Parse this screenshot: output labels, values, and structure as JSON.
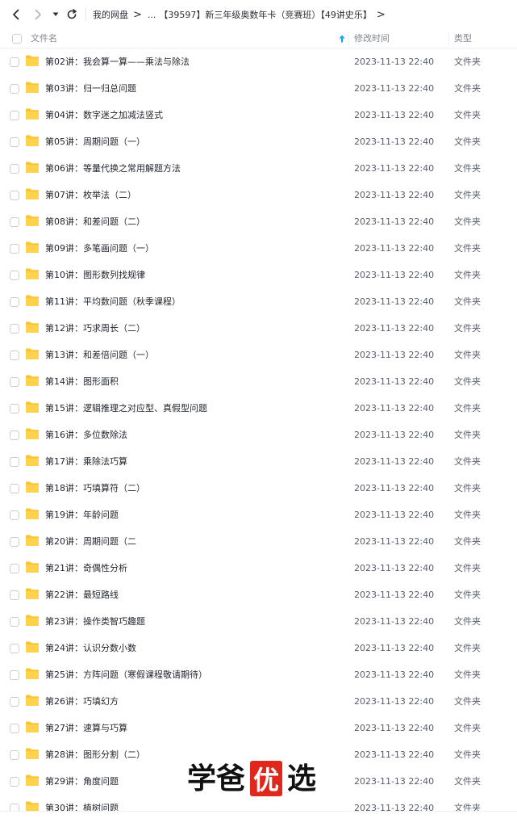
{
  "breadcrumb": {
    "root": "我的网盘",
    "ellipsis": "...",
    "current": "【39597】新三年级奥数年卡（竞赛班）【49讲史乐】"
  },
  "columns": {
    "name": "文件名",
    "modified": "修改时间",
    "type": "类型"
  },
  "sort": {
    "column": "name",
    "direction": "ascending",
    "icon": "arrow-up-icon"
  },
  "colors": {
    "folder": "#f9c531",
    "accent": "#06a7ff",
    "watermark_red": "#e0271b"
  },
  "files": [
    {
      "name": "第02讲：我会算一算——乘法与除法",
      "modified": "2023-11-13 22:40",
      "type": "文件夹"
    },
    {
      "name": "第03讲：归一归总问题",
      "modified": "2023-11-13 22:40",
      "type": "文件夹"
    },
    {
      "name": "第04讲：数字迷之加减法竖式",
      "modified": "2023-11-13 22:40",
      "type": "文件夹"
    },
    {
      "name": "第05讲：周期问题（一）",
      "modified": "2023-11-13 22:40",
      "type": "文件夹"
    },
    {
      "name": "第06讲：等量代换之常用解题方法",
      "modified": "2023-11-13 22:40",
      "type": "文件夹"
    },
    {
      "name": "第07讲：枚举法（二）",
      "modified": "2023-11-13 22:40",
      "type": "文件夹"
    },
    {
      "name": "第08讲：和差问题（二）",
      "modified": "2023-11-13 22:40",
      "type": "文件夹"
    },
    {
      "name": "第09讲：多笔画问题（一）",
      "modified": "2023-11-13 22:40",
      "type": "文件夹"
    },
    {
      "name": "第10讲：图形数列找规律",
      "modified": "2023-11-13 22:40",
      "type": "文件夹"
    },
    {
      "name": "第11讲：平均数问题（秋季课程）",
      "modified": "2023-11-13 22:40",
      "type": "文件夹"
    },
    {
      "name": "第12讲：巧求周长（二）",
      "modified": "2023-11-13 22:40",
      "type": "文件夹"
    },
    {
      "name": "第13讲：和差倍问题（一）",
      "modified": "2023-11-13 22:40",
      "type": "文件夹"
    },
    {
      "name": "第14讲：图形面积",
      "modified": "2023-11-13 22:40",
      "type": "文件夹"
    },
    {
      "name": "第15讲：逻辑推理之对应型、真假型问题",
      "modified": "2023-11-13 22:40",
      "type": "文件夹"
    },
    {
      "name": "第16讲：多位数除法",
      "modified": "2023-11-13 22:40",
      "type": "文件夹"
    },
    {
      "name": "第17讲：乘除法巧算",
      "modified": "2023-11-13 22:40",
      "type": "文件夹"
    },
    {
      "name": "第18讲：巧填算符（二）",
      "modified": "2023-11-13 22:40",
      "type": "文件夹"
    },
    {
      "name": "第19讲：年龄问题",
      "modified": "2023-11-13 22:40",
      "type": "文件夹"
    },
    {
      "name": "第20讲：周期问题（二",
      "modified": "2023-11-13 22:40",
      "type": "文件夹"
    },
    {
      "name": "第21讲：奇偶性分析",
      "modified": "2023-11-13 22:40",
      "type": "文件夹"
    },
    {
      "name": "第22讲：最短路线",
      "modified": "2023-11-13 22:40",
      "type": "文件夹"
    },
    {
      "name": "第23讲：操作类智巧趣题",
      "modified": "2023-11-13 22:40",
      "type": "文件夹"
    },
    {
      "name": "第24讲：认识分数小数",
      "modified": "2023-11-13 22:40",
      "type": "文件夹"
    },
    {
      "name": "第25讲：方阵问题（寒假课程敬请期待）",
      "modified": "2023-11-13 22:40",
      "type": "文件夹"
    },
    {
      "name": "第26讲：巧填幻方",
      "modified": "2023-11-13 22:40",
      "type": "文件夹"
    },
    {
      "name": "第27讲：速算与巧算",
      "modified": "2023-11-13 22:40",
      "type": "文件夹"
    },
    {
      "name": "第28讲：图形分割（二）",
      "modified": "2023-11-13 22:40",
      "type": "文件夹"
    },
    {
      "name": "第29讲：角度问题",
      "modified": "2023-11-13 22:40",
      "type": "文件夹"
    },
    {
      "name": "第30讲：植树问题",
      "modified": "2023-11-13 22:40",
      "type": "文件夹"
    }
  ],
  "watermark": {
    "left": "学爸",
    "boxed": "优",
    "right": "选"
  }
}
